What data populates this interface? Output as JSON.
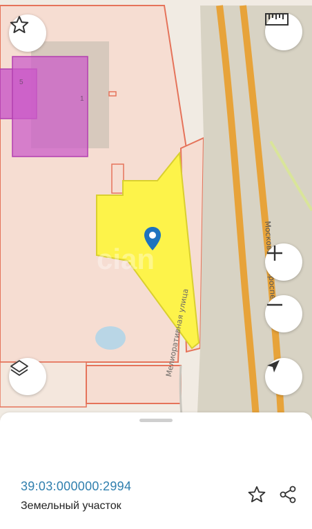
{
  "map": {
    "street_label": "Мелиоративная улица",
    "road_label": "Московский проспект",
    "watermark": "cian",
    "building_labels": [
      "5",
      "1"
    ],
    "colors": {
      "background": "#f1ebe3",
      "parcel_fill": "#f6ddd2",
      "parcel_stroke": "#e5735a",
      "selected_fill": "#fdf34a",
      "selected_stroke": "#d9cf2f",
      "building_fill": "#cb5ec8",
      "road_fill": "#d8d3c4",
      "road_orange": "#e7a33a",
      "marker": "#1e73be"
    }
  },
  "controls": {
    "favorite_icon": "star-outline-icon",
    "ruler_icon": "ruler-icon",
    "zoom_in_icon": "plus-icon",
    "zoom_out_icon": "minus-icon",
    "layers_icon": "layers-icon",
    "locate_icon": "navigation-arrow-icon"
  },
  "sheet": {
    "cadastral_number": "39:03:000000:2994",
    "object_type": "Земельный участок",
    "favorite_icon": "star-outline-icon",
    "share_icon": "share-icon"
  }
}
